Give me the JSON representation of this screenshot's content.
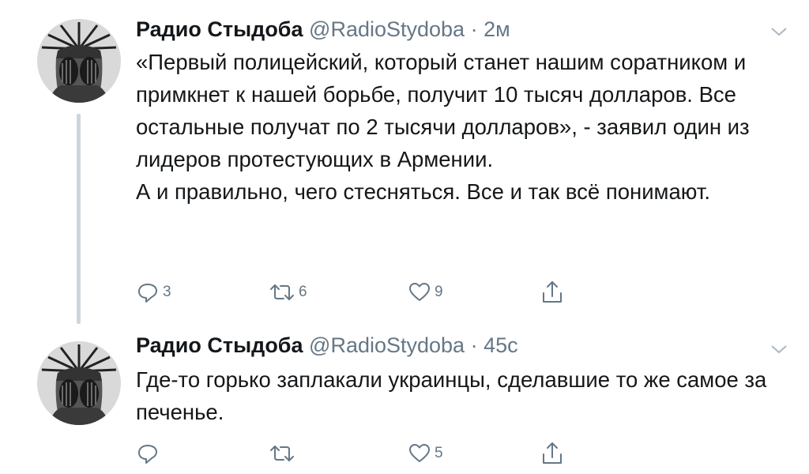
{
  "tweets": [
    {
      "name": "Радио Стыдоба",
      "handle": "@RadioStydoba",
      "separator": "·",
      "time": "2м",
      "text_lines": [
        "«Первый полицейский, который станет нашим соратником и примкнет к нашей борьбе, получит 10 тысяч долларов. Все остальные получат по 2 тысячи долларов», - заявил один из лидеров протестующих в Армении.",
        "А и правильно, чего стесняться. Все и так всё понимают."
      ],
      "replies": "3",
      "retweets": "6",
      "likes": "9"
    },
    {
      "name": "Радио Стыдоба",
      "handle": "@RadioStydoba",
      "separator": "·",
      "time": "45с",
      "text_lines": [
        "Где-то горько заплакали украинцы, сделавшие то же самое за печенье."
      ],
      "replies": "",
      "retweets": "",
      "likes": "5"
    }
  ],
  "icons": {
    "reply": "reply-icon",
    "retweet": "retweet-icon",
    "like": "heart-icon",
    "share": "share-icon",
    "caret": "chevron-down-icon",
    "avatar": "statue-of-liberty-facepalm-avatar"
  },
  "colors": {
    "text": "#14171a",
    "secondary": "#657786",
    "thread_line": "#ccd6dd",
    "background": "#ffffff"
  }
}
